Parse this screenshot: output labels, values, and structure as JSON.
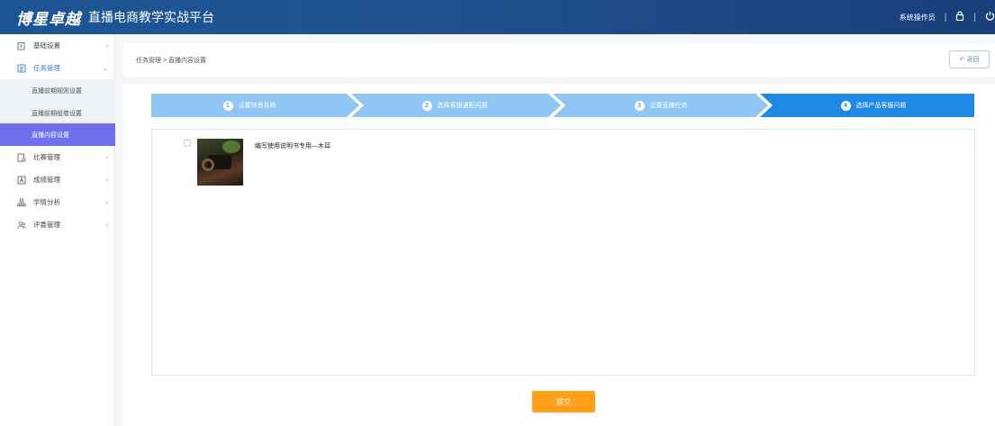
{
  "app": {
    "brand": "博星卓越",
    "title": "直播电商教学实战平台"
  },
  "topbar": {
    "user": "系统操作员",
    "sep": "|"
  },
  "sidebar": {
    "items": [
      {
        "label": "基础设置"
      },
      {
        "label": "任务管理"
      },
      {
        "label": "比赛管理"
      },
      {
        "label": "成绩管理"
      },
      {
        "label": "学情分析"
      },
      {
        "label": "评委管理"
      }
    ],
    "subitems": [
      {
        "label": "直播前期规则设置"
      },
      {
        "label": "直播前期组卷设置"
      },
      {
        "label": "直播内容设置"
      }
    ]
  },
  "breadcrumb": {
    "text": "任务管理 > 直播内容设置"
  },
  "back_button": {
    "label": "返回"
  },
  "steps": [
    {
      "num": "1",
      "label": "设置场景名称"
    },
    {
      "num": "2",
      "label": "选择客服通配问题"
    },
    {
      "num": "3",
      "label": "设置直播任务"
    },
    {
      "num": "4",
      "label": "选择产品客服问题"
    }
  ],
  "product": {
    "name": "编写使用说明书专用—木耳"
  },
  "submit": {
    "label": "提交"
  },
  "colors": {
    "step_inactive": "#8ec6f5",
    "step_active": "#1e88e5",
    "submit": "#ff9f1a",
    "sidebar_current": "#6f70ee"
  }
}
